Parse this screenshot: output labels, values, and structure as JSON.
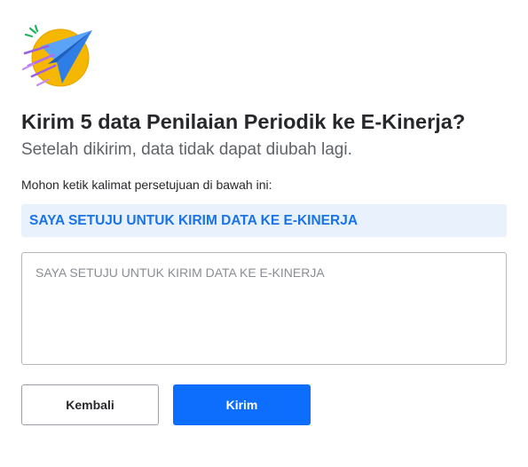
{
  "dialog": {
    "illustration_icon": "paper-plane-icon",
    "title": "Kirim 5 data Penilaian Periodik ke E-Kinerja?",
    "subtitle": "Setelah dikirim, data tidak dapat diubah lagi.",
    "instruction": "Mohon ketik kalimat persetujuan di bawah ini:",
    "confirmation_phrase": "SAYA SETUJU UNTUK KIRIM DATA KE E-KINERJA",
    "input": {
      "value": "",
      "placeholder": "SAYA SETUJU UNTUK KIRIM DATA KE E-KINERJA"
    },
    "buttons": {
      "back_label": "Kembali",
      "send_label": "Kirim"
    }
  },
  "colors": {
    "accent": "#0d6efd",
    "phrase_background": "#e8f1fc",
    "phrase_text": "#1a73e8",
    "illustration_circle": "#f5b700",
    "illustration_plane": "#3d8bf2",
    "illustration_trails": "#9b5de5",
    "illustration_sparks": "#22b35e"
  }
}
